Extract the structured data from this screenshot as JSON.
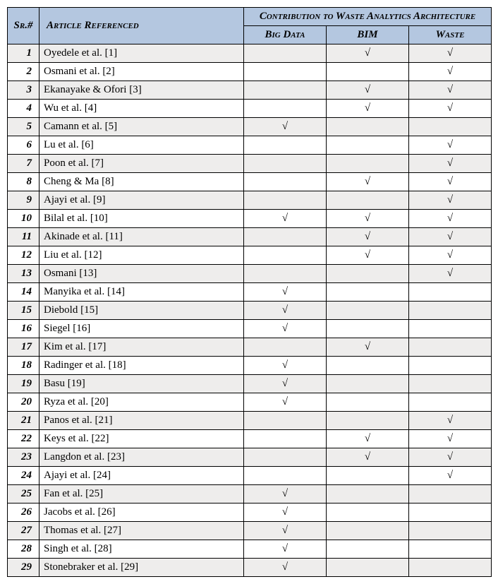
{
  "header": {
    "sr": "Sr.#",
    "article": "Article Referenced",
    "contrib": "Contribution to Waste Analytics Architecture",
    "bigdata": "Big Data",
    "bim": "BIM",
    "waste": "Waste"
  },
  "rows": [
    {
      "sr": "1",
      "article": "Oyedele et al. [1]",
      "bigdata": "",
      "bim": "√",
      "waste": "√"
    },
    {
      "sr": "2",
      "article": "Osmani et al. [2]",
      "bigdata": "",
      "bim": "",
      "waste": "√"
    },
    {
      "sr": "3",
      "article": "Ekanayake & Ofori [3]",
      "bigdata": "",
      "bim": "√",
      "waste": "√"
    },
    {
      "sr": "4",
      "article": "Wu et al. [4]",
      "bigdata": "",
      "bim": "√",
      "waste": "√"
    },
    {
      "sr": "5",
      "article": "Camann et al. [5]",
      "bigdata": "√",
      "bim": "",
      "waste": ""
    },
    {
      "sr": "6",
      "article": "Lu et al. [6]",
      "bigdata": "",
      "bim": "",
      "waste": "√"
    },
    {
      "sr": "7",
      "article": "Poon et al. [7]",
      "bigdata": "",
      "bim": "",
      "waste": "√"
    },
    {
      "sr": "8",
      "article": "Cheng & Ma [8]",
      "bigdata": "",
      "bim": "√",
      "waste": "√"
    },
    {
      "sr": "9",
      "article": "Ajayi et al. [9]",
      "bigdata": "",
      "bim": "",
      "waste": "√"
    },
    {
      "sr": "10",
      "article": "Bilal et al. [10]",
      "bigdata": "√",
      "bim": "√",
      "waste": "√"
    },
    {
      "sr": "11",
      "article": "Akinade et al. [11]",
      "bigdata": "",
      "bim": "√",
      "waste": "√"
    },
    {
      "sr": "12",
      "article": "Liu et al. [12]",
      "bigdata": "",
      "bim": "√",
      "waste": "√"
    },
    {
      "sr": "13",
      "article": "Osmani [13]",
      "bigdata": "",
      "bim": "",
      "waste": "√"
    },
    {
      "sr": "14",
      "article": "Manyika et al. [14]",
      "bigdata": "√",
      "bim": "",
      "waste": ""
    },
    {
      "sr": "15",
      "article": "Diebold [15]",
      "bigdata": "√",
      "bim": "",
      "waste": ""
    },
    {
      "sr": "16",
      "article": "Siegel [16]",
      "bigdata": "√",
      "bim": "",
      "waste": ""
    },
    {
      "sr": "17",
      "article": "Kim et al. [17]",
      "bigdata": "",
      "bim": "√",
      "waste": ""
    },
    {
      "sr": "18",
      "article": "Radinger et al. [18]",
      "bigdata": "√",
      "bim": "",
      "waste": ""
    },
    {
      "sr": "19",
      "article": "Basu [19]",
      "bigdata": "√",
      "bim": "",
      "waste": ""
    },
    {
      "sr": "20",
      "article": "Ryza et al. [20]",
      "bigdata": "√",
      "bim": "",
      "waste": ""
    },
    {
      "sr": "21",
      "article": "Panos et al. [21]",
      "bigdata": "",
      "bim": "",
      "waste": "√"
    },
    {
      "sr": "22",
      "article": "Keys et al. [22]",
      "bigdata": "",
      "bim": "√",
      "waste": "√"
    },
    {
      "sr": "23",
      "article": "Langdon et al. [23]",
      "bigdata": "",
      "bim": "√",
      "waste": "√"
    },
    {
      "sr": "24",
      "article": "Ajayi et al. [24]",
      "bigdata": "",
      "bim": "",
      "waste": "√"
    },
    {
      "sr": "25",
      "article": "Fan et al. [25]",
      "bigdata": "√",
      "bim": "",
      "waste": ""
    },
    {
      "sr": "26",
      "article": "Jacobs et al. [26]",
      "bigdata": "√",
      "bim": "",
      "waste": ""
    },
    {
      "sr": "27",
      "article": "Thomas et al. [27]",
      "bigdata": "√",
      "bim": "",
      "waste": ""
    },
    {
      "sr": "28",
      "article": "Singh et al. [28]",
      "bigdata": "√",
      "bim": "",
      "waste": ""
    },
    {
      "sr": "29",
      "article": "Stonebraker et al. [29]",
      "bigdata": "√",
      "bim": "",
      "waste": ""
    }
  ]
}
